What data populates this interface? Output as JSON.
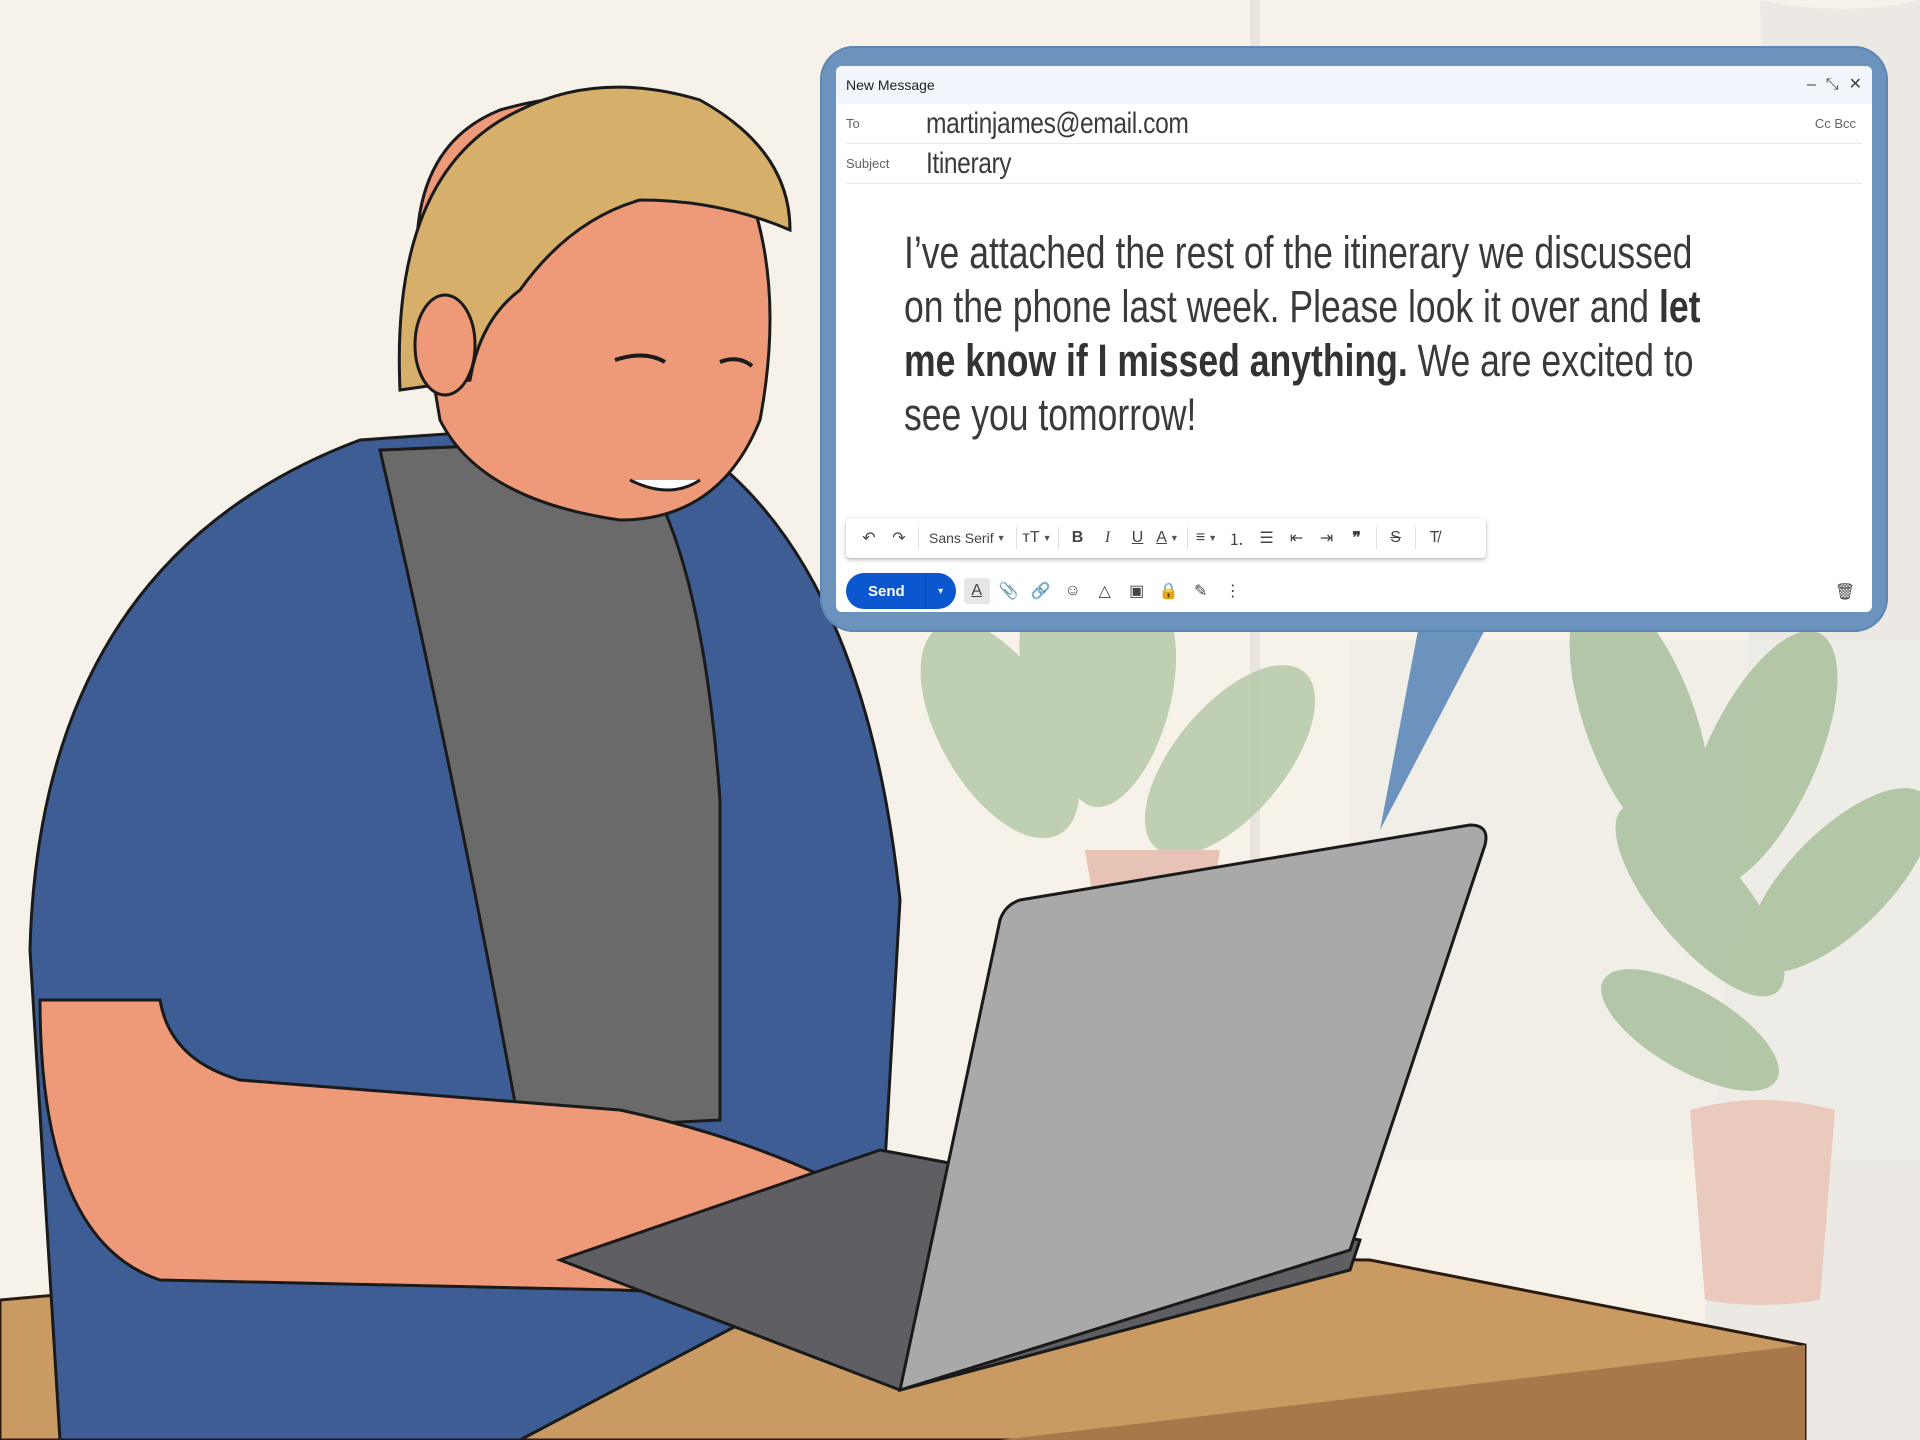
{
  "compose": {
    "title": "New Message",
    "controls": {
      "minimize": "–",
      "expand": "⤡",
      "close": "✕"
    },
    "to_label": "To",
    "to_value": "martinjames@email.com",
    "cc_bcc": "Cc Bcc",
    "subject_label": "Subject",
    "subject_value": "Itinerary",
    "body": {
      "part1": "I’ve attached the rest of the itinerary we discussed on the phone last week. Please look it over and ",
      "bold": "let me know if I missed anything.",
      "part2": " We are excited to see you tomorrow!"
    }
  },
  "format_toolbar": {
    "undo": "↶",
    "redo": "↷",
    "font": "Sans Serif",
    "font_size": "тT",
    "bold": "B",
    "italic": "I",
    "underline": "U",
    "text_color": "A",
    "align": "≡",
    "numbered_list": "⒈",
    "bulleted_list": "☰",
    "indent_less": "⇤",
    "indent_more": "⇥",
    "quote": "❞",
    "strikethrough": "S",
    "clear_formatting": "T̸"
  },
  "bottom_toolbar": {
    "send_label": "Send",
    "send_dropdown": "▾",
    "icons": [
      "formatting-icon",
      "attach-icon",
      "link-icon",
      "emoji-icon",
      "drive-icon",
      "photo-icon",
      "confidential-icon",
      "signature-icon",
      "more-options-icon"
    ],
    "glyphs": [
      "A",
      "📎",
      "🔗",
      "☺",
      "△",
      "▣",
      "🔒",
      "✎",
      "⋮"
    ],
    "trash": "🗑"
  },
  "colors": {
    "bubble": "#6b93bd",
    "send_button": "#0b57d0",
    "header_bg": "#f2f6fc",
    "wall": "#f6f2ea",
    "desk_top": "#c99a62",
    "desk_side": "#a8784a",
    "shirt": "#3e5d95",
    "tshirt": "#6a6a6a",
    "skin": "#ee9a78",
    "hair": "#d6b06a",
    "laptop": "#a9a9a9"
  }
}
